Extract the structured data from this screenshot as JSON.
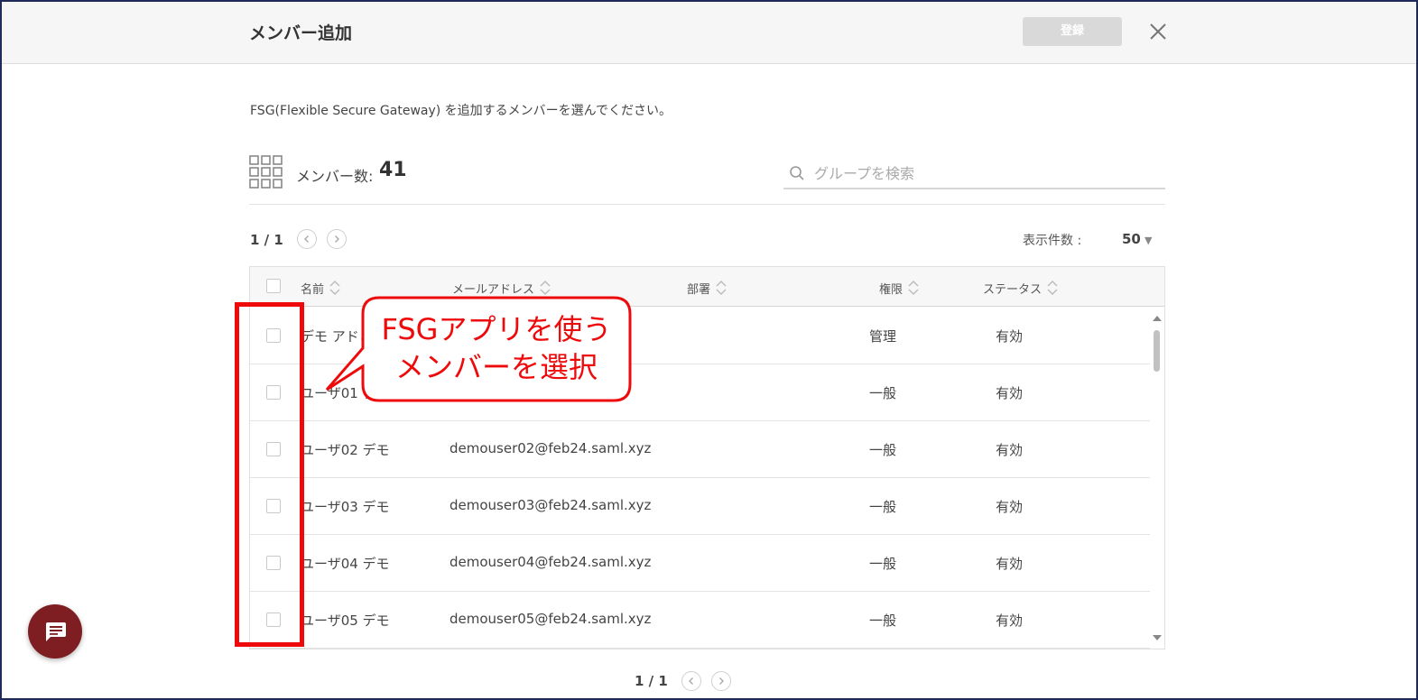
{
  "dialog": {
    "title": "メンバー追加",
    "register_label": "登録",
    "instruction": "FSG(Flexible Secure Gateway) を追加するメンバーを選んでください。"
  },
  "members": {
    "label": "メンバー数:",
    "count": "41"
  },
  "search": {
    "placeholder": "グループを検索"
  },
  "pagination": {
    "top": "1 / 1",
    "bottom": "1 / 1",
    "per_page_label": "表示件数 :",
    "per_page_value": "50"
  },
  "table": {
    "headers": {
      "name": "名前",
      "email": "メールアドレス",
      "dept": "部署",
      "role": "権限",
      "status": "ステータス"
    },
    "rows": [
      {
        "name": "デモ アドミ",
        "email": "",
        "role": "管理",
        "status": "有効"
      },
      {
        "name": "ユーザ01 デ",
        "email": "",
        "role": "一般",
        "status": "有効"
      },
      {
        "name": "ユーザ02 デモ",
        "email": "demouser02@feb24.saml.xyz",
        "role": "一般",
        "status": "有効"
      },
      {
        "name": "ユーザ03 デモ",
        "email": "demouser03@feb24.saml.xyz",
        "role": "一般",
        "status": "有効"
      },
      {
        "name": "ユーザ04 デモ",
        "email": "demouser04@feb24.saml.xyz",
        "role": "一般",
        "status": "有効"
      },
      {
        "name": "ユーザ05 デモ",
        "email": "demouser05@feb24.saml.xyz",
        "role": "一般",
        "status": "有効"
      }
    ]
  },
  "annotation": {
    "line1": "FSGアプリを使う",
    "line2": "メンバーを選択"
  },
  "colors": {
    "accent_red": "#ee0a0a",
    "chat_button": "#7e1e22",
    "header_bg": "#f6f6f6"
  }
}
